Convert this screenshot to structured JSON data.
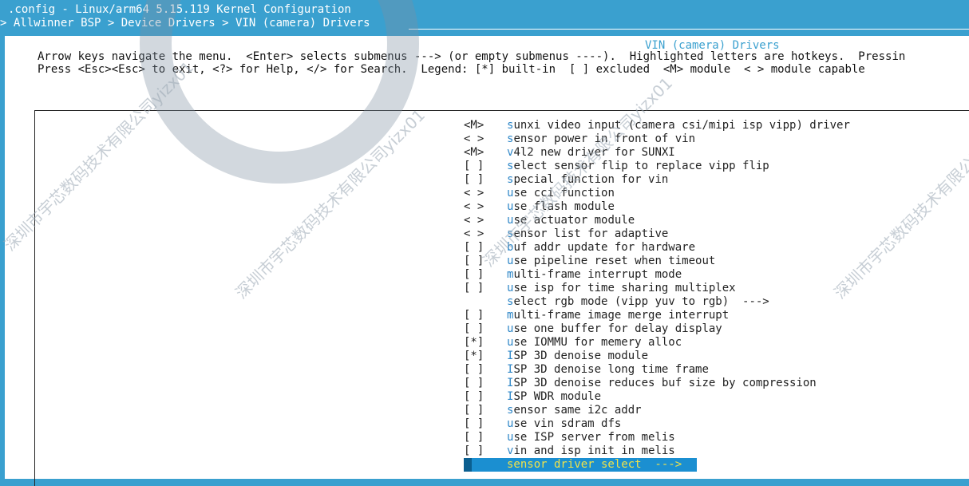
{
  "header": {
    "title": ".config - Linux/arm64 5.15.119 Kernel Configuration",
    "breadcrumb": "> Allwinner BSP > Device Drivers > VIN (camera) Drivers"
  },
  "dialog": {
    "title": "VIN (camera) Drivers",
    "help_line1": "Arrow keys navigate the menu.  <Enter> selects submenus ---> (or empty submenus ----).  Highlighted letters are hotkeys.  Pressin",
    "help_line2": "Press <Esc><Esc> to exit, <?> for Help, </> for Search.  Legend: [*] built-in  [ ] excluded  <M> module  < > module capable"
  },
  "menu": {
    "items": [
      {
        "marker": "<M>",
        "hotkey": "s",
        "rest": "unxi video input (camera csi/mipi isp vipp) driver",
        "indent": ""
      },
      {
        "marker": "< >",
        "hotkey": "s",
        "rest": "ensor power in front of vin",
        "indent": "  "
      },
      {
        "marker": "<M>",
        "hotkey": "v",
        "rest": "4l2 new driver for SUNXI",
        "indent": "  "
      },
      {
        "marker": "[ ]",
        "hotkey": "s",
        "rest": "elect sensor flip to replace vipp flip",
        "indent": "  "
      },
      {
        "marker": "[ ]",
        "hotkey": "s",
        "rest": "pecial function for vin",
        "indent": "  "
      },
      {
        "marker": "< >",
        "hotkey": "u",
        "rest": "se cci function",
        "indent": "  "
      },
      {
        "marker": "< >",
        "hotkey": "u",
        "rest": "se flash module",
        "indent": "  "
      },
      {
        "marker": "< >",
        "hotkey": "u",
        "rest": "se actuator module",
        "indent": "  "
      },
      {
        "marker": "< >",
        "hotkey": "s",
        "rest": "ensor list for adaptive",
        "indent": "  "
      },
      {
        "marker": "[ ]",
        "hotkey": "b",
        "rest": "uf addr update for hardware",
        "indent": "  "
      },
      {
        "marker": "[ ]",
        "hotkey": "u",
        "rest": "se pipeline reset when timeout",
        "indent": "  "
      },
      {
        "marker": "[ ]",
        "hotkey": "m",
        "rest": "ulti-frame interrupt mode",
        "indent": "  "
      },
      {
        "marker": "[ ]",
        "hotkey": "u",
        "rest": "se isp for time sharing multiplex",
        "indent": "  "
      },
      {
        "marker": "   ",
        "hotkey": "s",
        "rest": "elect rgb mode (vipp yuv to rgb)  --->",
        "indent": "  "
      },
      {
        "marker": "[ ]",
        "hotkey": "m",
        "rest": "ulti-frame image merge interrupt",
        "indent": "  "
      },
      {
        "marker": "[ ]",
        "hotkey": "u",
        "rest": "se one buffer for delay display",
        "indent": "  "
      },
      {
        "marker": "[*]",
        "hotkey": "u",
        "rest": "se IOMMU for memery alloc",
        "indent": "  "
      },
      {
        "marker": "[*]",
        "hotkey": "I",
        "rest": "SP 3D denoise module",
        "indent": "  "
      },
      {
        "marker": "[ ]",
        "hotkey": "I",
        "rest": "SP 3D denoise long time frame",
        "indent": "    "
      },
      {
        "marker": "[ ]",
        "hotkey": "I",
        "rest": "SP 3D denoise reduces buf size by compression",
        "indent": "    "
      },
      {
        "marker": "[ ]",
        "hotkey": "I",
        "rest": "SP WDR module",
        "indent": "  "
      },
      {
        "marker": "[ ]",
        "hotkey": "s",
        "rest": "ensor same i2c addr",
        "indent": "  "
      },
      {
        "marker": "[ ]",
        "hotkey": "u",
        "rest": "se vin sdram dfs",
        "indent": "  "
      },
      {
        "marker": "[ ]",
        "hotkey": "u",
        "rest": "se ISP server from melis",
        "indent": "  "
      },
      {
        "marker": "[ ]",
        "hotkey": "v",
        "rest": "in and isp init in melis",
        "indent": "  "
      }
    ],
    "selected": {
      "text": "sensor driver select  --->"
    }
  },
  "watermark": {
    "text": "深圳市宇芯数码技术有限公司yizx01"
  },
  "colors": {
    "background": "#3aa0cf",
    "selection": "#1b8fd1",
    "hotkey": "#2d86c7",
    "selected_text": "#f0e24a"
  }
}
